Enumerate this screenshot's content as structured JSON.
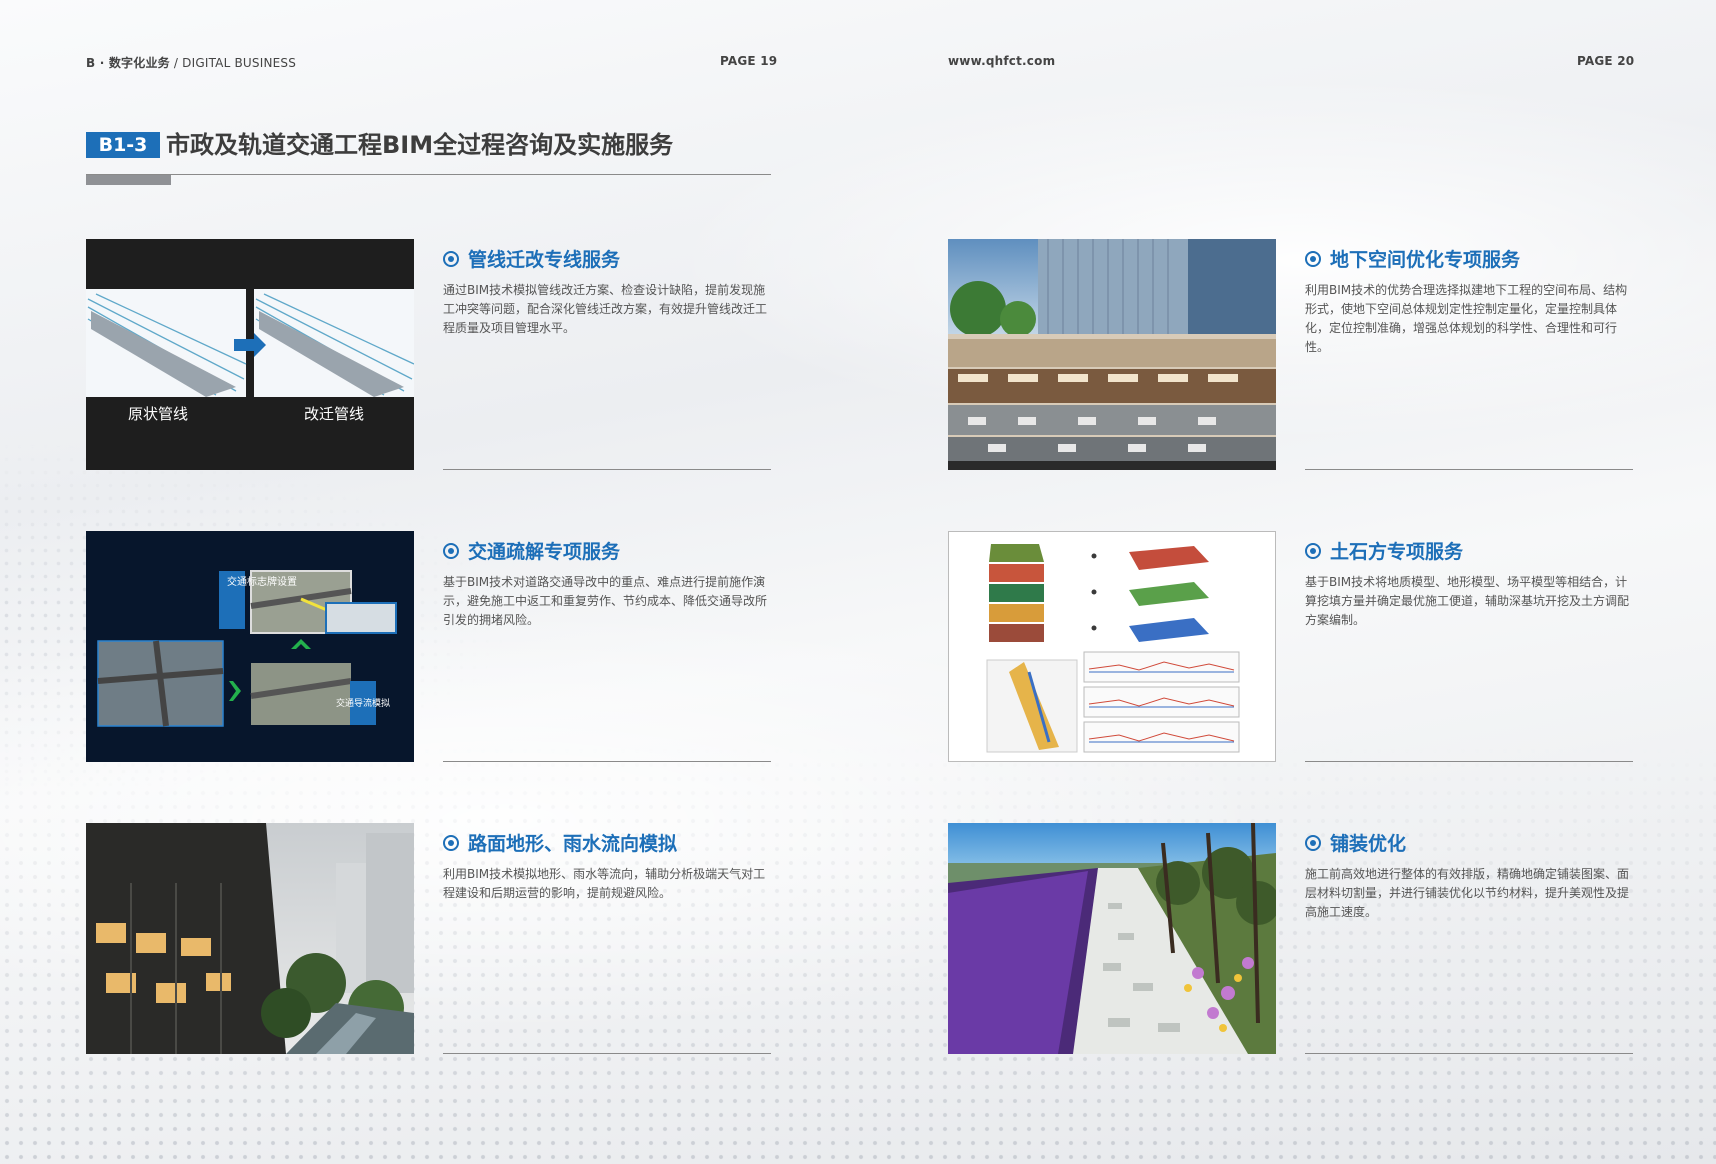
{
  "header": {
    "left_section": "B · 数字化业务",
    "left_separator": "/",
    "left_english": "DIGITAL BUSINESS",
    "page_left": "PAGE 19",
    "website": "www.qhfct.com",
    "page_right": "PAGE 20"
  },
  "title": {
    "badge": "B1-3",
    "text": "市政及轨道交通工程BIM全过程咨询及实施服务"
  },
  "sections": [
    {
      "title": "管线迁改专线服务",
      "desc": "通过BIM技术模拟管线改迁方案、检查设计缺陷，提前发现施工冲突等问题，配合深化管线迁改方案，有效提升管线改迁工程质量及项目管理水平。",
      "image_labels": [
        "原状管线",
        "改迁管线"
      ]
    },
    {
      "title": "地下空间优化专项服务",
      "desc": "利用BIM技术的优势合理选择拟建地下工程的空间布局、结构形式，使地下空间总体规划定性控制定量化，定量控制具体化，定位控制准确，增强总体规划的科学性、合理性和可行性。"
    },
    {
      "title": "交通疏解专项服务",
      "desc": "基于BIM技术对道路交通导改中的重点、难点进行提前施作演示，避免施工中返工和重复劳作、节约成本、降低交通导改所引发的拥堵风险。",
      "image_labels": [
        "交通标志牌设置",
        "交通导流模拟"
      ]
    },
    {
      "title": "土石方专项服务",
      "desc": "基于BIM技术将地质模型、地形模型、场平模型等相结合，计算挖填方量并确定最优施工便道，辅助深基坑开挖及土方调配方案编制。"
    },
    {
      "title": "路面地形、雨水流向模拟",
      "desc": "利用BIM技术模拟地形、雨水等流向，辅助分析极端天气对工程建设和后期运营的影响，提前规避风险。"
    },
    {
      "title": "铺装优化",
      "desc": "施工前高效地进行整体的有效排版，精确地确定铺装图案、面层材料切割量，并进行铺装优化以节约材料，提升美观性及提高施工速度。"
    }
  ]
}
